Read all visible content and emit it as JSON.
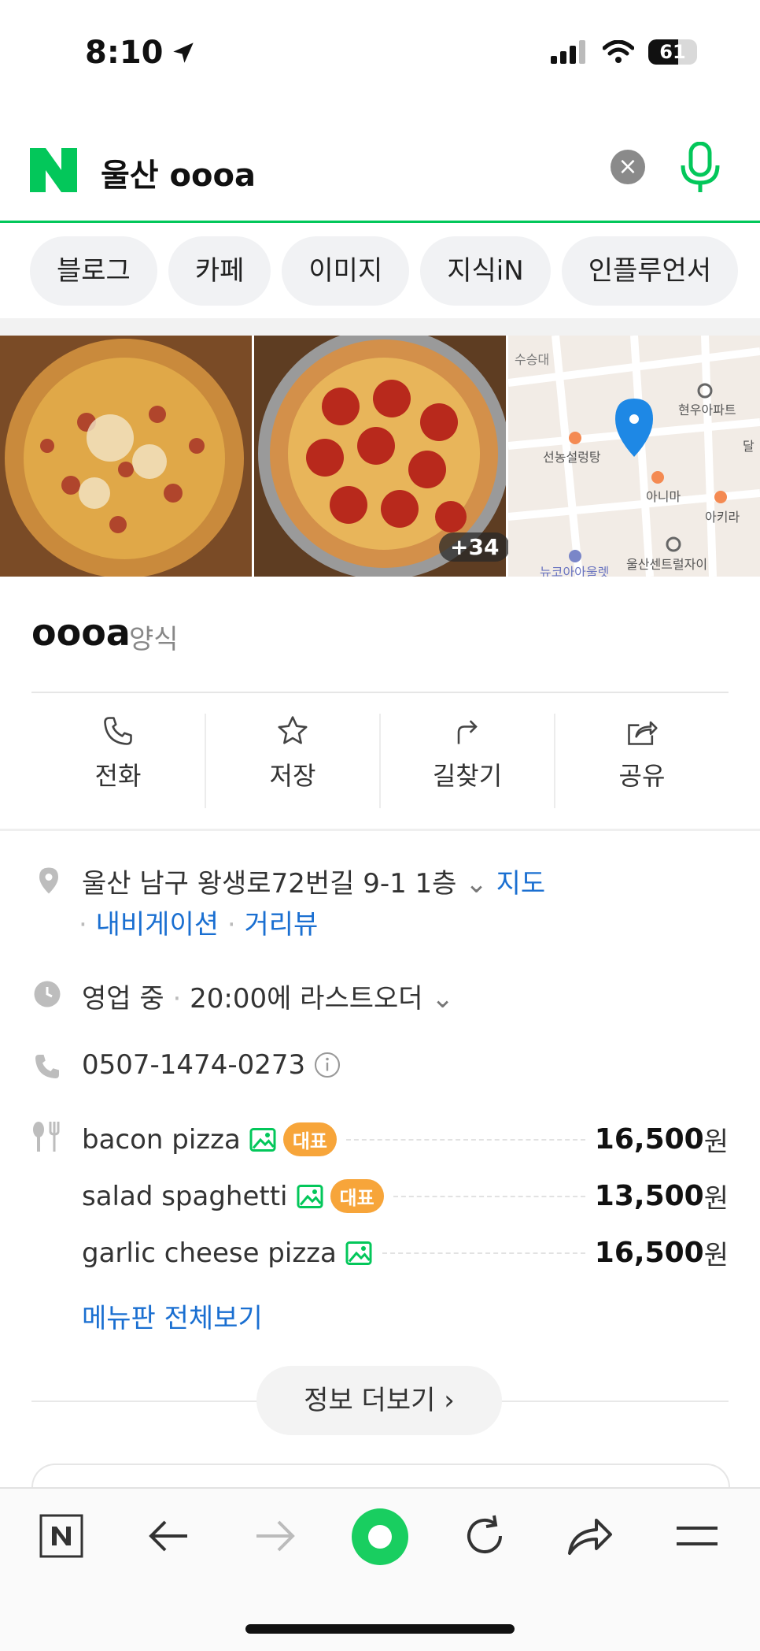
{
  "status_bar": {
    "time": "8:10",
    "battery": "61",
    "battery_fraction": 0.61
  },
  "search": {
    "query": "울산 oooa"
  },
  "tabs": [
    {
      "label": "블로그"
    },
    {
      "label": "카페"
    },
    {
      "label": "이미지"
    },
    {
      "label": "지식iN"
    },
    {
      "label": "인플루언서"
    }
  ],
  "gallery": {
    "more_count": "+34",
    "map_labels": [
      "수승대",
      "현우아파트",
      "선농설렁탕",
      "아니마",
      "아키라",
      "울산센트럴자이",
      "뉴코아아울렛",
      "달"
    ]
  },
  "place": {
    "name": "oooa",
    "category": "양식"
  },
  "actions": [
    {
      "label": "전화",
      "icon": "phone-icon"
    },
    {
      "label": "저장",
      "icon": "star-icon"
    },
    {
      "label": "길찾기",
      "icon": "directions-icon"
    },
    {
      "label": "공유",
      "icon": "share-icon"
    }
  ],
  "address": {
    "text": "울산 남구 왕생로72번길 9-1 1층",
    "map_link": "지도",
    "nav_link": "내비게이션",
    "street_link": "거리뷰"
  },
  "hours": {
    "status": "영업 중",
    "detail": "20:00에 라스트오더"
  },
  "phone": {
    "number": "0507-1474-0273"
  },
  "menu": {
    "items": [
      {
        "name": "bacon pizza",
        "badge": "대표",
        "price": "16,500",
        "unit": "원"
      },
      {
        "name": "salad spaghetti",
        "badge": "대표",
        "price": "13,500",
        "unit": "원"
      },
      {
        "name": "garlic cheese pizza",
        "badge": "",
        "price": "16,500",
        "unit": "원"
      }
    ],
    "view_all": "메뉴판 전체보기"
  },
  "more_info": {
    "label": "정보 더보기"
  },
  "colors": {
    "naver_green": "#03c75a",
    "link_blue": "#1a6fd1",
    "badge_orange": "#f7a53a",
    "map_pin_blue": "#1e88e5"
  }
}
